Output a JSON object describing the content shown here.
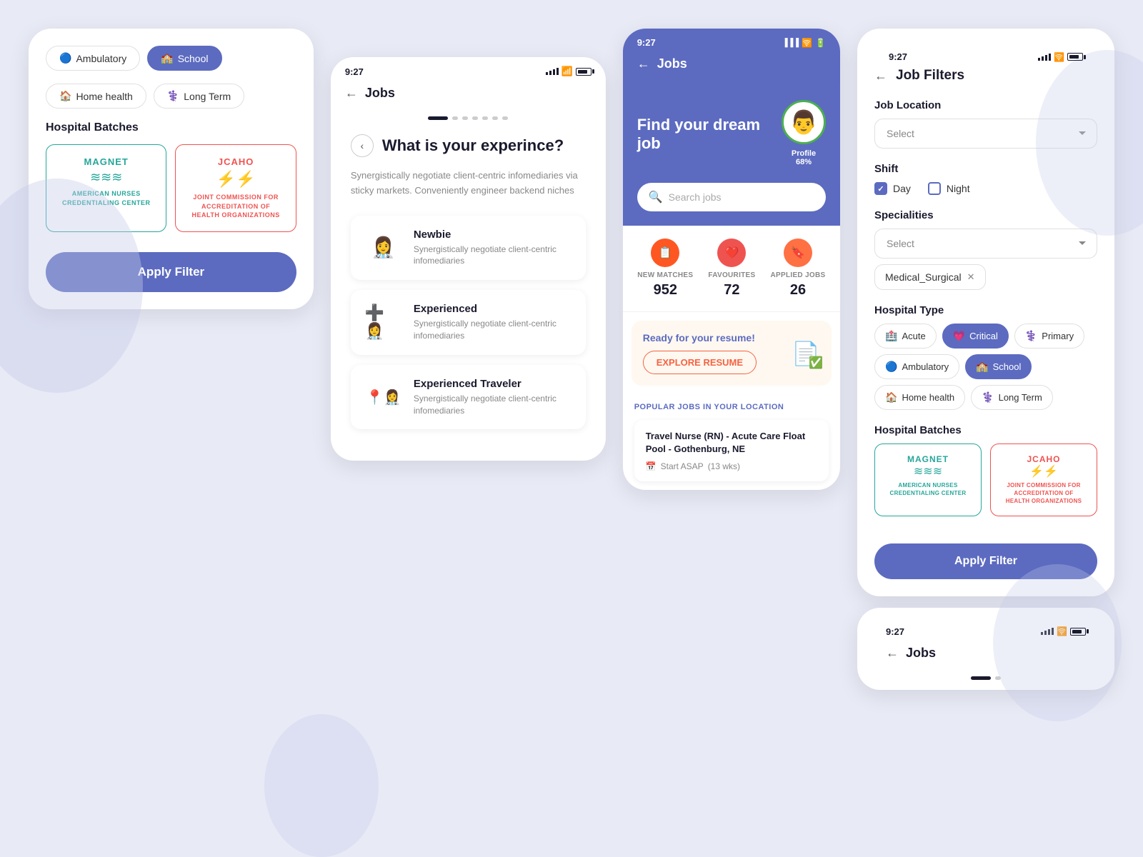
{
  "background": "#e8eaf6",
  "panel_filters_left": {
    "tags": [
      {
        "label": "Ambulatory",
        "icon": "🔵",
        "active": false
      },
      {
        "label": "School",
        "icon": "🏫",
        "active": true
      }
    ],
    "second_row_tags": [
      {
        "label": "Home health",
        "icon": "🏠",
        "active": false
      },
      {
        "label": "Long Term",
        "icon": "⚕️",
        "active": false
      }
    ],
    "section_title": "Hospital Batches",
    "batches": [
      {
        "type": "magnet",
        "title": "MAGNET",
        "subtitle": "AMERICAN NURSES\nCREDENTIALING CENTER",
        "symbol": "≋"
      },
      {
        "type": "jcaho",
        "title": "JCAHO",
        "subtitle": "JOINT COMMISSION FOR\nACCREDITATION OF\nHEALTH ORGANIZATIONS",
        "symbol": "⚡"
      }
    ],
    "apply_btn": "Apply Filter"
  },
  "panel_experience": {
    "time": "9:27",
    "nav_title": "Jobs",
    "question": "What is your experince?",
    "description": "Synergistically negotiate client-centric infomediaries via sticky markets. Conveniently engineer backend niches",
    "options": [
      {
        "label": "Newbie",
        "desc": "Synergistically negotiate client-centric infomediaries",
        "icon": "👩‍⚕️"
      },
      {
        "label": "Experienced",
        "desc": "Synergistically negotiate client-centric infomediaries",
        "icon": "👩‍⚕️"
      },
      {
        "label": "Experienced Traveler",
        "desc": "Synergistically negotiate client-centric infomediaries",
        "icon": "👩‍⚕️"
      }
    ]
  },
  "panel_dream_job": {
    "time": "9:27",
    "nav_title": "Jobs",
    "banner_title": "Find your dream job",
    "profile_label": "Profile",
    "profile_pct": "68%",
    "search_placeholder": "Search jobs",
    "stats": [
      {
        "label": "NEW MATCHES",
        "value": "952",
        "icon": "📋"
      },
      {
        "label": "FAVOURITES",
        "value": "72",
        "icon": "❤️"
      },
      {
        "label": "APPLIED JOBS",
        "value": "26",
        "icon": "🔖"
      }
    ],
    "resume_title": "Ready for your resume!",
    "explore_btn": "EXPLORE RESUME",
    "popular_label": "POPULAR JOBS IN YOUR LOCATION",
    "job_title": "Travel Nurse (RN) - Acute Care Float Pool - Gothenburg, NE",
    "job_start": "Start ASAP",
    "job_duration": "(13 wks)"
  },
  "panel_filters_right": {
    "time": "9:27",
    "back_label": "←",
    "title": "Job Filters",
    "location_label": "Job Location",
    "location_placeholder": "Select",
    "shift_label": "Shift",
    "shift_day": "Day",
    "shift_day_checked": true,
    "shift_night": "Night",
    "shift_night_checked": false,
    "specialities_label": "Specialities",
    "specialities_placeholder": "Select",
    "active_specialty": "Medical_Surgical",
    "hospital_type_label": "Hospital Type",
    "hospital_types": [
      {
        "label": "Acute",
        "icon": "🏥",
        "active": false
      },
      {
        "label": "Critical",
        "icon": "💗",
        "active": true
      },
      {
        "label": "Primary",
        "icon": "⚕️",
        "active": false
      },
      {
        "label": "Ambulatory",
        "icon": "🔵",
        "active": false
      },
      {
        "label": "School",
        "icon": "🏫",
        "active": true
      },
      {
        "label": "Home health",
        "icon": "🏠",
        "active": false
      },
      {
        "label": "Long Term",
        "icon": "⚕️",
        "active": false
      }
    ],
    "hospital_batches_label": "Hospital Batches",
    "batches": [
      {
        "type": "magnet",
        "title": "MAGNET",
        "subtitle": "AMERICAN NURSES\nCREDENTIALING CENTER"
      },
      {
        "type": "jcaho",
        "title": "JCAHO",
        "subtitle": "JOINT COMMISSION FOR\nACCREDITATION OF\nHEALTH ORGANIZATIONS"
      }
    ],
    "apply_btn": "Apply Filter"
  },
  "panel_jobs_bottom": {
    "time": "9:27",
    "nav_title": "Jobs"
  }
}
